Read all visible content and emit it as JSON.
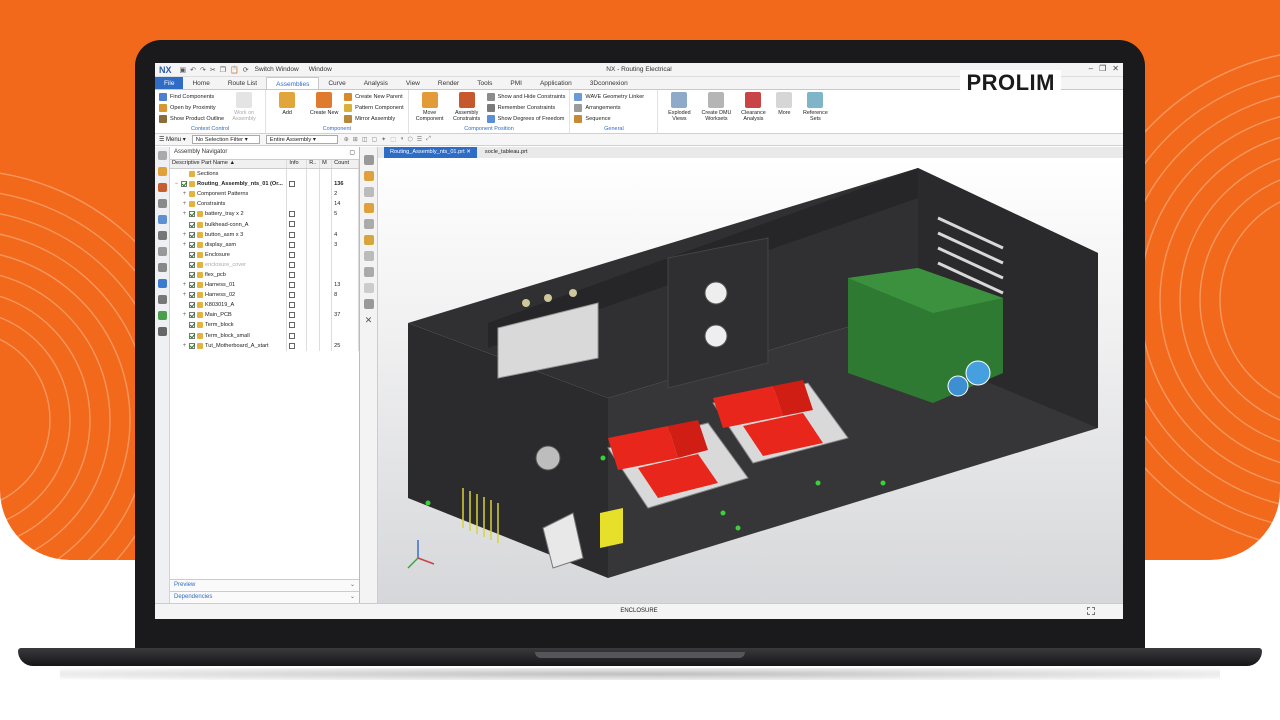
{
  "brand": {
    "name": "PROLIM"
  },
  "window": {
    "logo": "NX",
    "title": "NX - Routing Electrical",
    "switch_window": "Switch Window",
    "window_menu": "Window"
  },
  "tabs": [
    "File",
    "Home",
    "Route List",
    "Assemblies",
    "Curve",
    "Analysis",
    "View",
    "Render",
    "Tools",
    "PMI",
    "Application",
    "3Dconnexion"
  ],
  "ribbon": {
    "context_control": {
      "label": "Context Control",
      "items": [
        "Find Components",
        "Open by Proximity",
        "Show Product Outline"
      ],
      "disabled_button": "Work on Assembly"
    },
    "component": {
      "label": "Component",
      "add": "Add",
      "create_new": "Create New",
      "items": [
        "Create New Parent",
        "Pattern Component",
        "Mirror Assembly"
      ]
    },
    "component_position": {
      "label": "Component Position",
      "move": "Move Component",
      "constraints": "Assembly Constraints",
      "items": [
        "Show and Hide Constraints",
        "Remember Constraints",
        "Show Degrees of Freedom"
      ]
    },
    "general": {
      "label": "General",
      "items": [
        "WAVE Geometry Linker",
        "Arrangements",
        "Sequence"
      ]
    },
    "extra": {
      "exploded": "Exploded Views",
      "dmu": "Create DMU Worksets",
      "clearance": "Clearance Analysis",
      "more": "More",
      "reference": "Reference Sets"
    }
  },
  "command_bar": {
    "menu": "Menu",
    "selection_filter": "No Selection Filter",
    "scope": "Entire Assembly"
  },
  "navigator": {
    "title": "Assembly Navigator",
    "columns": [
      "Descriptive Part Name",
      "Info",
      "R..",
      "M",
      "Count"
    ],
    "rows": [
      {
        "name": "Sections",
        "count": "",
        "indent": 1,
        "exp": "",
        "chk": false,
        "bold": false,
        "faded": false,
        "info": false
      },
      {
        "name": "Routing_Assembly_nts_01 (Or...",
        "count": "136",
        "indent": 0,
        "exp": "−",
        "chk": true,
        "bold": true,
        "faded": false,
        "info": true
      },
      {
        "name": "Component Patterns",
        "count": "2",
        "indent": 1,
        "exp": "+",
        "chk": false,
        "bold": false,
        "faded": false,
        "info": false
      },
      {
        "name": "Constraints",
        "count": "14",
        "indent": 1,
        "exp": "+",
        "chk": false,
        "bold": false,
        "faded": false,
        "info": false
      },
      {
        "name": "battery_tray x 2",
        "count": "5",
        "indent": 1,
        "exp": "+",
        "chk": true,
        "bold": false,
        "faded": false,
        "info": true
      },
      {
        "name": "bulkhead-conn_A",
        "count": "",
        "indent": 1,
        "exp": "",
        "chk": true,
        "bold": false,
        "faded": false,
        "info": true
      },
      {
        "name": "button_asm x 3",
        "count": "4",
        "indent": 1,
        "exp": "+",
        "chk": true,
        "bold": false,
        "faded": false,
        "info": true
      },
      {
        "name": "display_asm",
        "count": "3",
        "indent": 1,
        "exp": "+",
        "chk": true,
        "bold": false,
        "faded": false,
        "info": true
      },
      {
        "name": "Enclosure",
        "count": "",
        "indent": 1,
        "exp": "",
        "chk": true,
        "bold": false,
        "faded": false,
        "info": true
      },
      {
        "name": "enclosure_cover",
        "count": "",
        "indent": 1,
        "exp": "",
        "chk": true,
        "bold": false,
        "faded": true,
        "info": true
      },
      {
        "name": "flex_pcb",
        "count": "",
        "indent": 1,
        "exp": "",
        "chk": true,
        "bold": false,
        "faded": false,
        "info": true
      },
      {
        "name": "Harness_01",
        "count": "13",
        "indent": 1,
        "exp": "+",
        "chk": true,
        "bold": false,
        "faded": false,
        "info": true
      },
      {
        "name": "Harness_02",
        "count": "8",
        "indent": 1,
        "exp": "+",
        "chk": true,
        "bold": false,
        "faded": false,
        "info": true
      },
      {
        "name": "K803019_A",
        "count": "",
        "indent": 1,
        "exp": "",
        "chk": true,
        "bold": false,
        "faded": false,
        "info": true
      },
      {
        "name": "Main_PCB",
        "count": "37",
        "indent": 1,
        "exp": "+",
        "chk": true,
        "bold": false,
        "faded": false,
        "info": true
      },
      {
        "name": "Term_block",
        "count": "",
        "indent": 1,
        "exp": "",
        "chk": true,
        "bold": false,
        "faded": false,
        "info": true
      },
      {
        "name": "Term_block_small",
        "count": "",
        "indent": 1,
        "exp": "",
        "chk": true,
        "bold": false,
        "faded": false,
        "info": true
      },
      {
        "name": "Tut_Motherboard_A_start",
        "count": "25",
        "indent": 1,
        "exp": "+",
        "chk": true,
        "bold": false,
        "faded": false,
        "info": true
      }
    ],
    "footer": [
      "Preview",
      "Dependencies"
    ]
  },
  "doc_tabs": [
    "Routing_Assembly_nts_01.prt",
    "socle_tableau.prt"
  ],
  "status": {
    "text": "ENCLOSURE"
  },
  "colors": {
    "accent": "#2e6cc6",
    "orange": "#f2691b",
    "enclosure": "#2b2b2d",
    "battery": "#e8261c",
    "pcb": "#2f7a32"
  }
}
